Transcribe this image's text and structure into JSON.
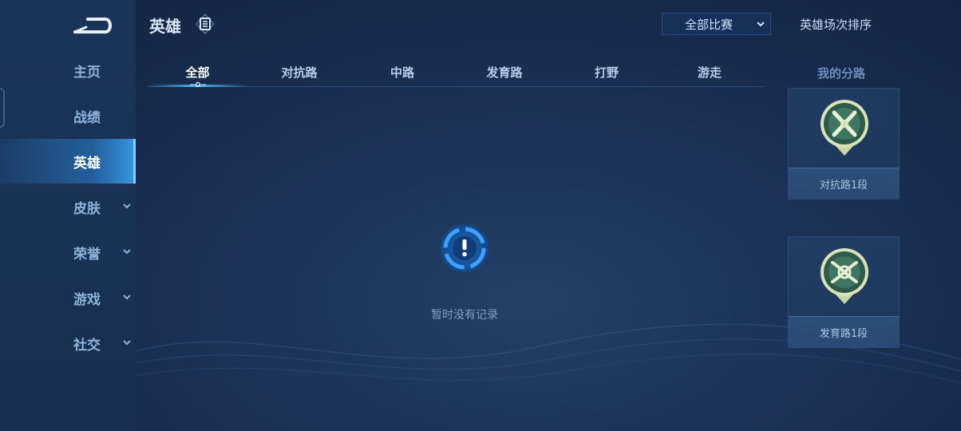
{
  "nav": {
    "items": [
      {
        "label": "主页",
        "has_chevron": false
      },
      {
        "label": "战绩",
        "has_chevron": false
      },
      {
        "label": "英雄",
        "has_chevron": false,
        "active": true
      },
      {
        "label": "皮肤",
        "has_chevron": true
      },
      {
        "label": "荣誉",
        "has_chevron": true
      },
      {
        "label": "游戏",
        "has_chevron": true
      },
      {
        "label": "社交",
        "has_chevron": true
      }
    ]
  },
  "header": {
    "title": "英雄",
    "filter_value": "全部比赛",
    "sort_label": "英雄场次排序"
  },
  "tabs": [
    "全部",
    "对抗路",
    "中路",
    "发育路",
    "打野",
    "游走"
  ],
  "active_tab": "全部",
  "empty_state": {
    "text": "暂时没有记录"
  },
  "lanes": {
    "title": "我的分路",
    "cards": [
      {
        "label": "对抗路1段",
        "icon": "crossed-swords-emblem-icon"
      },
      {
        "label": "发育路1段",
        "icon": "bow-emblem-icon"
      }
    ]
  },
  "colors": {
    "accent": "#53b6ff",
    "background": "#1c3458",
    "sidebar_active": "#2c84d6"
  }
}
